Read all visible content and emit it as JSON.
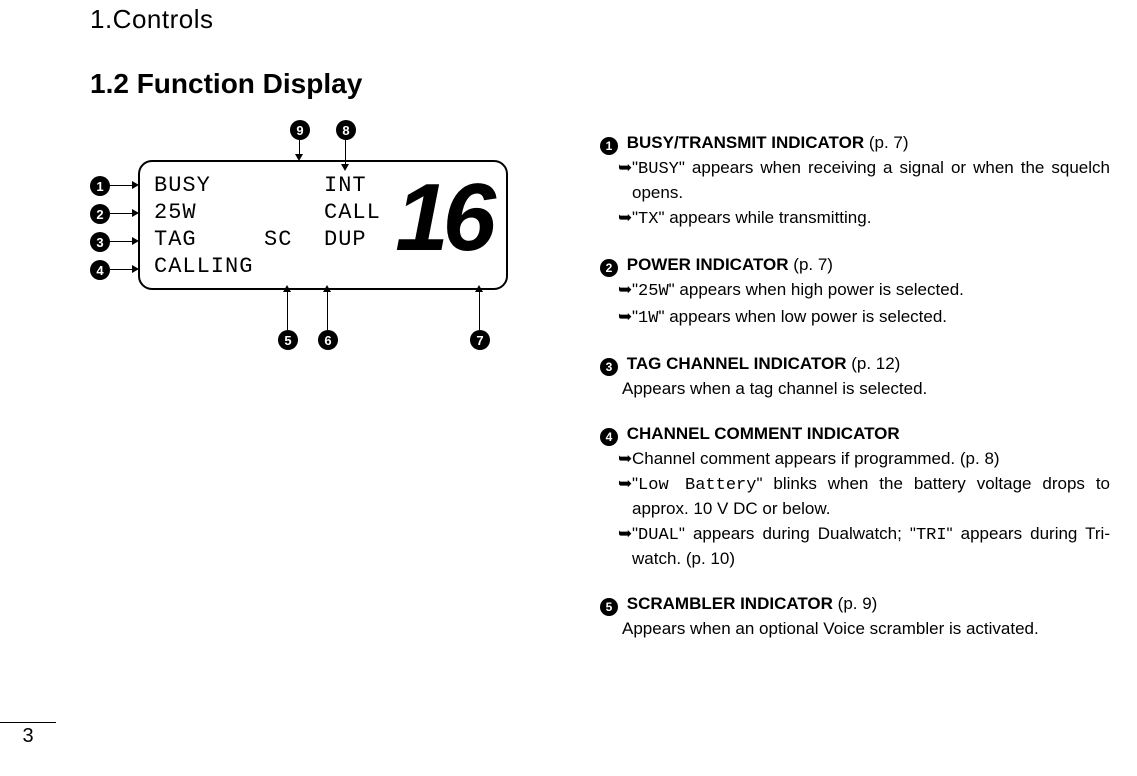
{
  "header": "1.Controls",
  "section_title": "1.2 Function Display",
  "page_number": "3",
  "lcd": {
    "r1c1": "BUSY",
    "r1c3": "INT",
    "r2c1": "25W",
    "r2c3": "CALL",
    "r3c1": "TAG",
    "r3c2": "SC",
    "r3c3": "DUP",
    "r4c1": "CALLING",
    "big": "16"
  },
  "callouts": {
    "n1": "1",
    "n2": "2",
    "n3": "3",
    "n4": "4",
    "n5": "5",
    "n6": "6",
    "n7": "7",
    "n8": "8",
    "n9": "9"
  },
  "arrow_glyph": "➥",
  "items": [
    {
      "num": "1",
      "title": "BUSY/TRANSMIT INDICATOR",
      "ref": " (p. 7)",
      "subs": [
        {
          "pre": "\"",
          "dot": "BUSY",
          "post": "\" appears when receiving a signal or when the squelch opens."
        },
        {
          "pre": "\"",
          "dot": "TX",
          "post": "\" appears while transmitting."
        }
      ]
    },
    {
      "num": "2",
      "title": "POWER INDICATOR",
      "ref": " (p. 7)",
      "subs": [
        {
          "pre": "\"",
          "dot": "25W",
          "post": "\" appears when high power is selected."
        },
        {
          "pre": "\"",
          "dot": "1W",
          "post": "\" appears when low power is selected."
        }
      ]
    },
    {
      "num": "3",
      "title": "TAG CHANNEL INDICATOR",
      "ref": " (p. 12)",
      "plain": "Appears when a tag channel is selected."
    },
    {
      "num": "4",
      "title": "CHANNEL COMMENT INDICATOR",
      "ref": "",
      "subs": [
        {
          "pre": "Channel comment appears if programmed. (p. 8)",
          "dot": "",
          "post": ""
        },
        {
          "pre": "\"",
          "dot": "Low Battery",
          "post": "\" blinks when the battery voltage drops to approx. 10 V DC or below."
        },
        {
          "pre": "\"",
          "dot": "DUAL",
          "post": "\" appears during Dualwatch; \"",
          "dot2": "TRI",
          "post2": "\" appears during Tri-watch. (p. 10)"
        }
      ]
    },
    {
      "num": "5",
      "title": "SCRAMBLER INDICATOR",
      "ref": " (p. 9)",
      "plain": "Appears when an optional Voice scrambler is activated."
    }
  ]
}
